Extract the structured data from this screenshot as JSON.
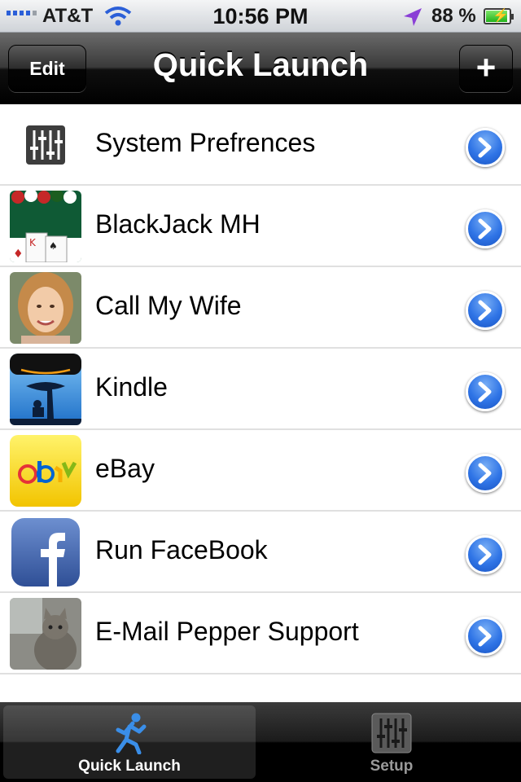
{
  "status_bar": {
    "carrier": "AT&T",
    "time": "10:56 PM",
    "battery_percent": "88 %",
    "signal_bars": 5
  },
  "nav": {
    "title": "Quick Launch",
    "edit_label": "Edit",
    "add_label": "+"
  },
  "items": [
    {
      "label": "System Prefrences",
      "icon": "sliders-icon"
    },
    {
      "label": "BlackJack MH",
      "icon": "blackjack-icon"
    },
    {
      "label": "Call My Wife",
      "icon": "contact-photo-icon"
    },
    {
      "label": "Kindle",
      "icon": "kindle-icon"
    },
    {
      "label": "eBay",
      "icon": "ebay-icon"
    },
    {
      "label": "Run FaceBook",
      "icon": "facebook-icon"
    },
    {
      "label": "E-Mail Pepper Support",
      "icon": "cat-photo-icon"
    }
  ],
  "tabs": [
    {
      "label": "Quick Launch",
      "active": true,
      "icon": "running-man-icon"
    },
    {
      "label": "Setup",
      "active": false,
      "icon": "sliders-icon"
    }
  ],
  "colors": {
    "accent": "#2f74e6",
    "navbar": "#000000",
    "active_tab_icon": "#3a8ee8"
  }
}
